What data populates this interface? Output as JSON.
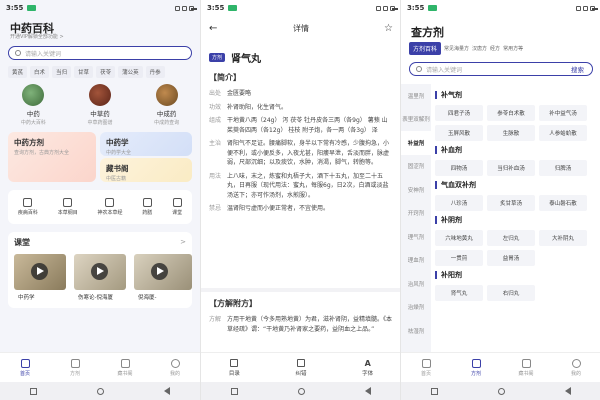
{
  "status": {
    "time": "3:55"
  },
  "home": {
    "title": "中药百科",
    "subtitle": "开通VIP解锁全部功能 >",
    "search_placeholder": "请输入关键词",
    "tags": [
      "黄芪",
      "白术",
      "当归",
      "甘草",
      "茯苓",
      "蒲公英",
      "丹参"
    ],
    "herbs": [
      {
        "name": "中药",
        "desc": "中药大百科"
      },
      {
        "name": "中草药",
        "desc": "中草药图谱"
      },
      {
        "name": "中成药",
        "desc": "中成药查询"
      }
    ],
    "card_formula": {
      "title": "中药方剂",
      "desc": "查询方剂，古典方剂大全"
    },
    "card_study": {
      "title": "中药学",
      "desc": "中药学大全"
    },
    "card_book": {
      "title": "藏书阁",
      "desc": "中医古籍"
    },
    "tools": [
      "疾病百科",
      "本草纲目",
      "神农本草经",
      "药膳",
      "课堂"
    ],
    "course": {
      "title": "课堂",
      "more": ">",
      "videos": [
        "中药学",
        "伤寒论-倪海厦",
        "倪海厦-"
      ]
    },
    "nav": [
      "首页",
      "方剂",
      "藏书阁",
      "我的"
    ]
  },
  "detail": {
    "header": "详情",
    "badge": "方剂",
    "name": "肾气丸",
    "sec1": "【简介】",
    "rows": [
      {
        "k": "出处",
        "v": "金匮要略"
      },
      {
        "k": "功效",
        "v": "补肾助阳，化生肾气。"
      },
      {
        "k": "组成",
        "v": "干地黄八两（24g） 泻 茯苓 牡丹皮各三两（各9g） 薯蓣 山茱萸各四两（各12g） 桂枝 附子炮，各一两（各3g） 泽"
      },
      {
        "k": "主治",
        "v": "肾阳气不足证。腰痛脚软，身半以下常有冷感，少腹拘急，小便不利，或小便反多，入夜尤甚，阳痿早泄，舌淡而胖，脉虚弱，尺部沉细；以及痰饮，水肿，消渴，脚气，转胞等。"
      },
      {
        "k": "用法",
        "v": "上八味，末之，炼蜜和丸梧子大，酒下十五丸，加至二十五丸，日再服（现代用法：蜜丸，每服6g，日2次，白酒或淡盐汤送下；亦可作汤剂，水煎服）。"
      },
      {
        "k": "禁忌",
        "v": "温肾阳亏虚而小便正常者，不宜使用。"
      }
    ],
    "sec2": "【方解附方】",
    "rows2": [
      {
        "k": "方解",
        "v": "方用干地黄（今多用熟地黄）为君，滋补肾阴，益精填髓。《本草经疏》谓：“干地黄乃补肾家之要药，益阴血之上品。”"
      }
    ],
    "tools": [
      "目录",
      "纠错",
      "字体"
    ]
  },
  "formula": {
    "title": "查方剂",
    "tabs": [
      "方剂百科",
      "常见海量方",
      "汉唐方",
      "经方",
      "常用方等"
    ],
    "search_placeholder": "请输入关键词",
    "search_btn": "搜索",
    "side": [
      "温里剂",
      "表里双解剂",
      "补益剂",
      "固涩剂",
      "安神剂",
      "开窍剂",
      "理气剂",
      "理血剂",
      "治风剂",
      "治燥剂",
      "祛湿剂"
    ],
    "groups": [
      {
        "name": "补气剂",
        "items": [
          "四君子汤",
          "参苓白术散",
          "补中益气汤",
          "玉屏风散",
          "生脉散",
          "人参蛤蚧散"
        ]
      },
      {
        "name": "补血剂",
        "items": [
          "四物汤",
          "当归补血汤",
          "归脾汤"
        ]
      },
      {
        "name": "气血双补剂",
        "items": [
          "八珍汤",
          "炙甘草汤",
          "泰山磐石散"
        ]
      },
      {
        "name": "补阴剂",
        "items": [
          "六味地黄丸",
          "左归丸",
          "大补阴丸",
          "一贯煎",
          "益胃汤"
        ]
      },
      {
        "name": "补阳剂",
        "items": [
          "肾气丸",
          "右归丸"
        ]
      }
    ],
    "nav": [
      "首页",
      "方剂",
      "藏书阁",
      "我的"
    ]
  }
}
